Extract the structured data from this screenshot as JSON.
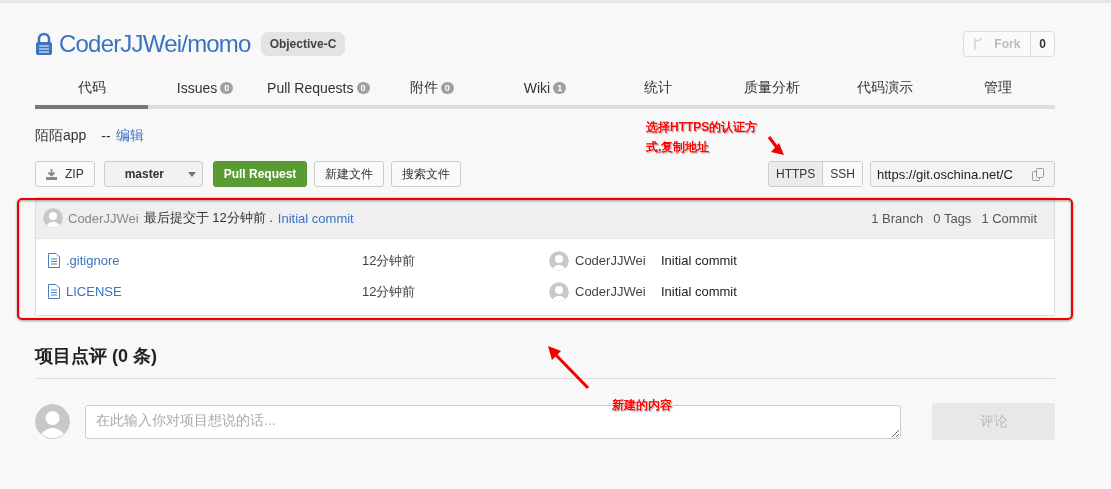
{
  "repo": {
    "title": "CoderJJWei/momo",
    "language": "Objective-C",
    "locked": true
  },
  "fork": {
    "label": "Fork",
    "count": "0"
  },
  "tabs": [
    {
      "label": "代码",
      "selected": true
    },
    {
      "label": "Issues",
      "count": "0",
      "selected": false
    },
    {
      "label": "Pull Requests",
      "count": "0",
      "selected": false
    },
    {
      "label": "附件",
      "count": "0",
      "selected": false
    },
    {
      "label": "Wiki",
      "count": "1",
      "selected": false
    },
    {
      "label": "统计",
      "selected": false
    },
    {
      "label": "质量分析",
      "selected": false
    },
    {
      "label": "代码演示",
      "selected": false
    },
    {
      "label": "管理",
      "selected": false
    }
  ],
  "description": {
    "text": "陌陌app",
    "separator": "--",
    "edit_link": "编辑"
  },
  "toolbar": {
    "zip": "ZIP",
    "branch": "master",
    "pull_request": "Pull Request",
    "new_file": "新建文件",
    "search_file": "搜索文件",
    "protocols": [
      {
        "label": "HTTPS",
        "selected": true
      },
      {
        "label": "SSH",
        "selected": false
      }
    ],
    "clone_url": "https://git.oschina.net/C"
  },
  "commit": {
    "author": "CoderJJWei",
    "action": "最后提交于 12分钟前 .",
    "message": "Initial commit",
    "stats": [
      "1 Branch",
      "0 Tags",
      "1 Commit"
    ]
  },
  "files": [
    {
      "name": ".gitignore",
      "time": "12分钟前",
      "author": "CoderJJWei",
      "message": "Initial commit"
    },
    {
      "name": "LICENSE",
      "time": "12分钟前",
      "author": "CoderJJWei",
      "message": "Initial commit"
    }
  ],
  "reviews": {
    "title": "项目点评 (0 条)",
    "placeholder": "在此输入你对项目想说的话...",
    "submit": "评论"
  },
  "annotations": [
    {
      "text": "选择HTTPS的认证方式,复制地址"
    },
    {
      "text": "新建的内容"
    }
  ]
}
